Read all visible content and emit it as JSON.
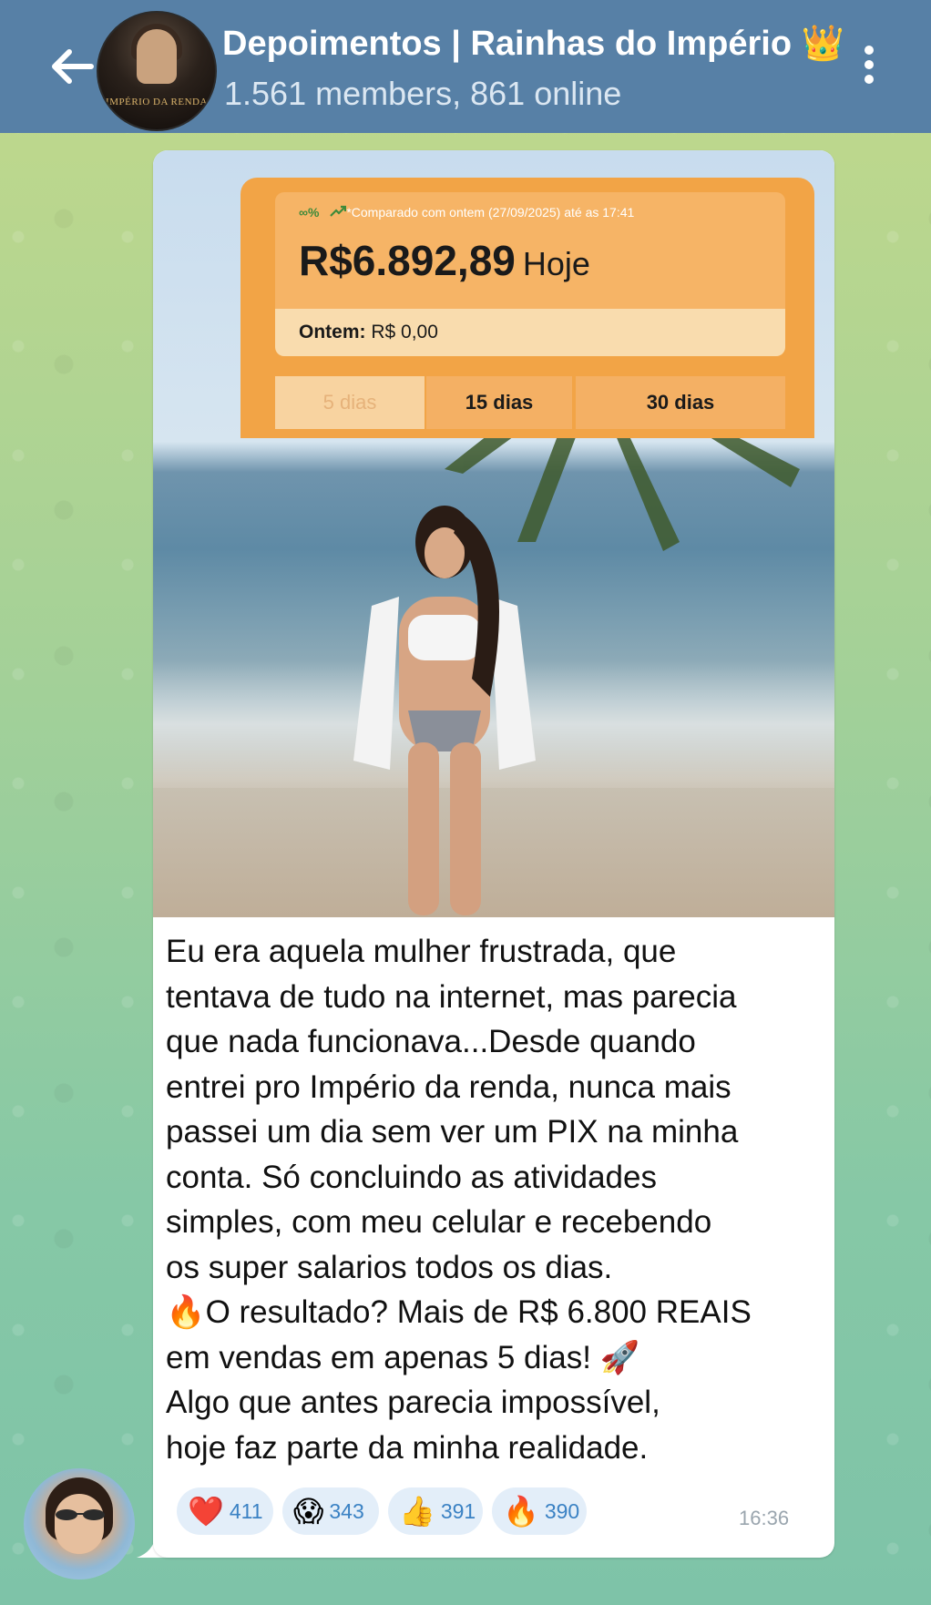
{
  "header": {
    "title": "Depoimentos | Rainhas do Império 👑",
    "subtitle": "1.561 members, 861 online",
    "avatar_logo_text": "IMPÉRIO DA RENDA"
  },
  "dashboard": {
    "percent_indicator": "∞%",
    "comparison_note": "*Comparado com ontem (27/09/2025) até as 17:41",
    "amount": "R$6.892,89",
    "today_label": "Hoje",
    "yesterday_label": "Ontem:",
    "yesterday_value": "R$ 0,00",
    "tabs": [
      "5 dias",
      "15 dias",
      "30 dias"
    ],
    "active_tab": "5 dias"
  },
  "message": {
    "text": "Eu era aquela mulher frustrada, que\ntentava de tudo na internet, mas parecia\nque nada funcionava...Desde quando\nentrei pro Império da renda, nunca mais\npassei um dia sem ver um PIX na minha\nconta. Só concluindo as atividades\nsimples, com meu celular  e recebendo\nos super salarios todos os dias.\n🔥O resultado? Mais de R$ 6.800 REAIS\nem vendas em apenas 5 dias! 🚀\n Algo que antes parecia impossível,\nhoje faz parte da minha realidade.",
    "time": "16:36"
  },
  "reactions": [
    {
      "emoji": "❤️",
      "count": "411",
      "name": "heart"
    },
    {
      "emoji": "😱",
      "count": "343",
      "name": "scream"
    },
    {
      "emoji": "👍",
      "count": "391",
      "name": "thumbs-up"
    },
    {
      "emoji": "🔥",
      "count": "390",
      "name": "fire"
    }
  ],
  "colors": {
    "header_bg": "#5780a6",
    "dashboard_orange": "#f2a446",
    "reaction_bg": "#e3eef9",
    "reaction_count": "#3b82c4"
  }
}
